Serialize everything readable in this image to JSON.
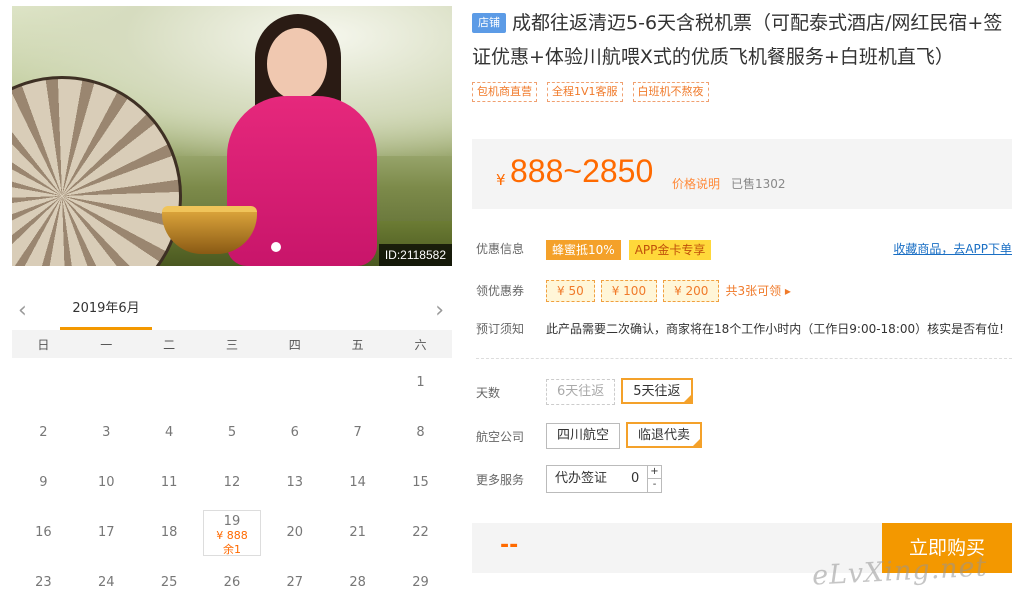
{
  "hero": {
    "image_id": "ID:2118582"
  },
  "calendar": {
    "month": "2019年6月",
    "prev_icon": "chevron-left-icon",
    "next_icon": "chevron-right-icon",
    "weekdays": [
      "日",
      "一",
      "二",
      "三",
      "四",
      "五",
      "六"
    ],
    "weeks": [
      [
        "",
        "",
        "",
        "",
        "",
        "",
        "1"
      ],
      [
        "2",
        "3",
        "4",
        "5",
        "6",
        "7",
        "8"
      ],
      [
        "9",
        "10",
        "11",
        "12",
        "13",
        "14",
        "15"
      ],
      [
        "16",
        "17",
        "18",
        "19",
        "20",
        "21",
        "22"
      ],
      [
        "23",
        "24",
        "25",
        "26",
        "27",
        "28",
        "29"
      ]
    ],
    "selected_day": {
      "day": "19",
      "price": "¥ 888",
      "remaining": "余1"
    }
  },
  "product": {
    "shop_badge": "店铺",
    "title": "成都往返清迈5-6天含税机票（可配泰式酒店/网红民宿+签证优惠+体验川航喂X式的优质飞机餐服务+白班机直飞）",
    "tags": [
      "包机商直营",
      "全程1V1客服",
      "白班机不熬夜"
    ]
  },
  "price": {
    "currency": "¥",
    "range": "888~2850",
    "explain_link": "价格说明",
    "sold": "已售1302"
  },
  "promo": {
    "label": "优惠信息",
    "badges": [
      "蜂蜜抵10%",
      "APP金卡专享"
    ],
    "favorite_link": "收藏商品，去APP下单"
  },
  "coupons": {
    "label": "领优惠券",
    "items": [
      "¥ 50",
      "¥ 100",
      "¥ 200"
    ],
    "more": "共3张可领 ▸"
  },
  "booking_notice": {
    "label": "预订须知",
    "text": "此产品需要二次确认，商家将在18个工作小时内（工作日9:00-18:00）核实是否有位!"
  },
  "options": {
    "days": {
      "label": "天数",
      "choices": [
        "6天往返",
        "5天往返"
      ]
    },
    "airline": {
      "label": "航空公司",
      "choices": [
        "四川航空",
        "临退代卖"
      ]
    },
    "services": {
      "label": "更多服务",
      "item": "代办签证",
      "qty": "0",
      "plus": "+",
      "minus": "-"
    }
  },
  "buy": {
    "price_placeholder": "--",
    "button_label": "立即购买"
  },
  "watermark": "eLvXing.net",
  "colors": {
    "accent": "#f39800",
    "price": "#ff6a00",
    "link": "#1a6fc4",
    "shop_badge": "#5c9be6"
  }
}
